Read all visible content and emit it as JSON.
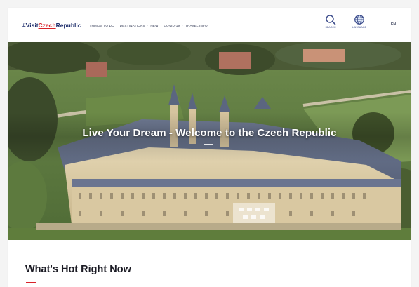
{
  "header": {
    "logo": {
      "part1": "#Visit",
      "part2": "Czech",
      "part3": "Republic"
    },
    "nav": [
      {
        "label": "Things to do"
      },
      {
        "label": "Destinations"
      },
      {
        "label": "New"
      },
      {
        "label": "Covid-19"
      },
      {
        "label": "Travel info"
      }
    ],
    "utilities": {
      "search_label": "Search",
      "language_label": "Language"
    },
    "language_code": "EN"
  },
  "hero": {
    "title": "Live Your Dream - Welcome to the Czech Republic"
  },
  "section": {
    "title": "What's Hot Right Now"
  },
  "colors": {
    "brand_blue": "#1d2d6b",
    "brand_red": "#d8232a",
    "icon_blue": "#3a4a8a"
  },
  "icons": [
    "search-icon",
    "globe-icon"
  ]
}
